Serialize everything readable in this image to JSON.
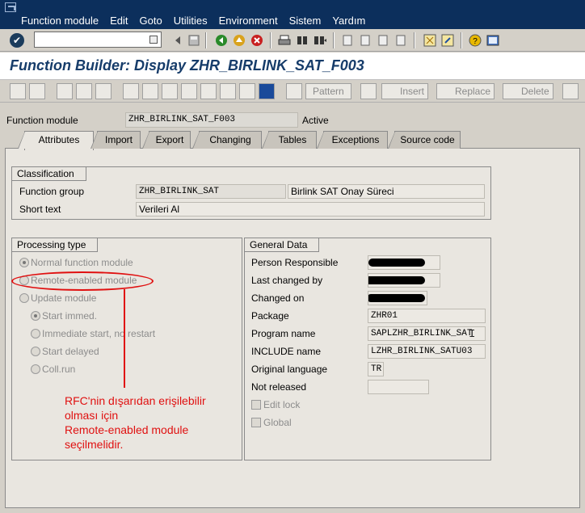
{
  "menubar": {
    "items": [
      "Function module",
      "Edit",
      "Goto",
      "Utilities",
      "Environment",
      "Sistem",
      "Yardım"
    ]
  },
  "toolbar": {
    "command_value": "",
    "icons": [
      "enter-icon",
      "back-icon",
      "save-icon",
      "back-arrow-icon",
      "exit-icon",
      "cancel-icon",
      "print-icon",
      "find-icon",
      "find-next-icon",
      "first-page-icon",
      "prev-page-icon",
      "next-page-icon",
      "last-page-icon",
      "new-session-icon",
      "shortcut-icon",
      "help-icon",
      "layout-icon"
    ]
  },
  "title": "Function Builder: Display ZHR_BIRLINK_SAT_F003",
  "app_toolbar": {
    "pattern": "Pattern",
    "insert": "Insert",
    "replace": "Replace",
    "delete": "Delete"
  },
  "header": {
    "label": "Function module",
    "value": "ZHR_BIRLINK_SAT_F003",
    "status": "Active"
  },
  "tabs": [
    "Attributes",
    "Import",
    "Export",
    "Changing",
    "Tables",
    "Exceptions",
    "Source code"
  ],
  "classification": {
    "title": "Classification",
    "group_label": "Function group",
    "group_value": "ZHR_BIRLINK_SAT",
    "group_desc": "Birlink SAT Onay Süreci",
    "short_text_label": "Short text",
    "short_text_value": "Verileri Al"
  },
  "processing": {
    "title": "Processing type",
    "normal": "Normal function module",
    "remote": "Remote-enabled module",
    "update": "Update module",
    "start_immed": "Start immed.",
    "immediate_no_restart": "Immediate start, no restart",
    "start_delayed": "Start delayed",
    "coll_run": "Coll.run"
  },
  "general": {
    "title": "General Data",
    "person_label": "Person Responsible",
    "changed_by_label": "Last changed by",
    "changed_on_label": "Changed on",
    "package_label": "Package",
    "package_value": "ZHR01",
    "program_label": "Program name",
    "program_value": "SAPLZHR_BIRLINK_SAT",
    "include_label": "INCLUDE name",
    "include_value": "LZHR_BIRLINK_SATU03",
    "language_label": "Original language",
    "language_value": "TR",
    "not_released_label": "Not released",
    "edit_lock_label": "Edit lock",
    "global_label": "Global"
  },
  "annotation": {
    "line1": "RFC'nin dışarıdan erişilebilir",
    "line2": "olması için",
    "line3": "Remote-enabled module",
    "line4": "seçilmelidir."
  },
  "colors": {
    "menubar": "#0c2f5c",
    "title": "#163c6a",
    "annotation": "#e01010"
  }
}
